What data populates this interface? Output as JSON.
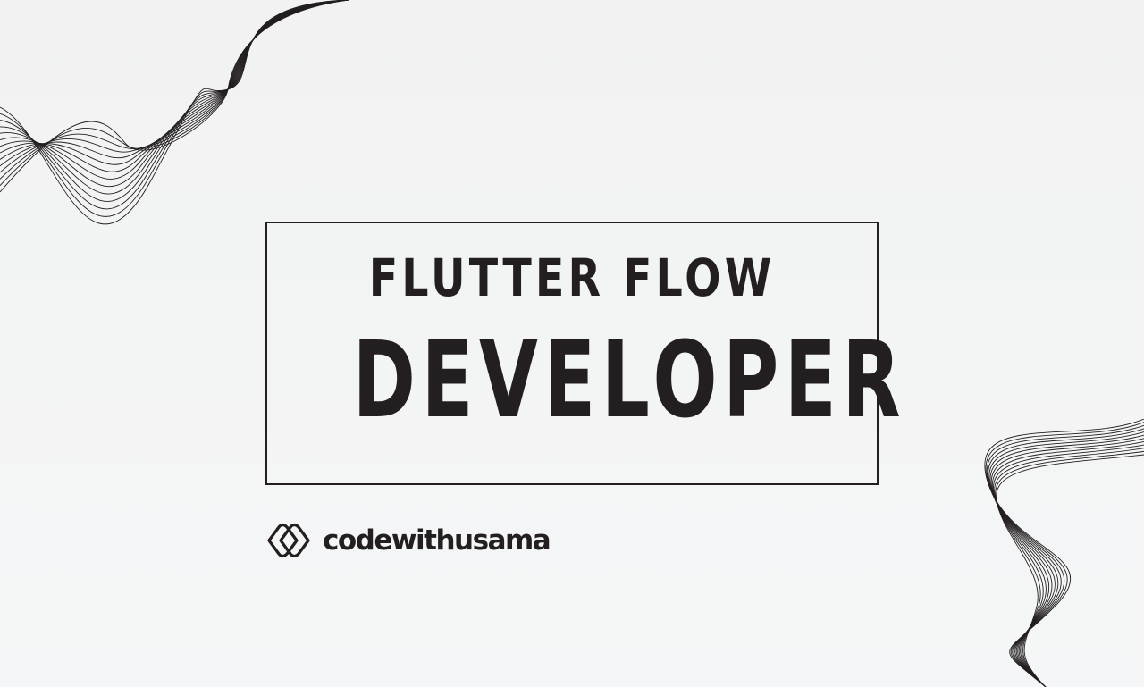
{
  "colors": {
    "ink": "#231f20",
    "background": "#f3f4f4"
  },
  "decorations": {
    "top_left": "wave-lines",
    "bottom_right": "wave-lines"
  },
  "title": {
    "subtitle": "FLUTTER FLOW",
    "headline": "DEVELOPER"
  },
  "brand": {
    "logo_icon": "interlocking-rounded-diamonds-icon",
    "name": "codewithusama"
  }
}
